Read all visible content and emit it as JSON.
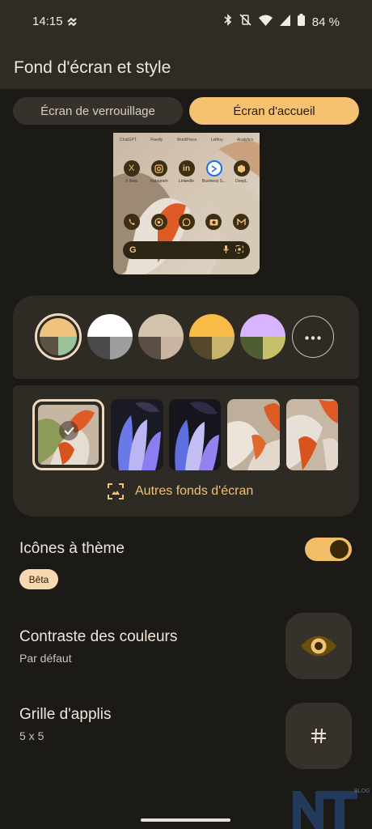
{
  "status_bar": {
    "time": "14:15",
    "battery_percent": "84 %",
    "icons": [
      "vpn-key-icon",
      "bluetooth-icon",
      "vibrate-off-icon",
      "wifi-icon",
      "cellular-signal-icon",
      "battery-icon"
    ]
  },
  "header": {
    "title": "Fond d'écran et style"
  },
  "tabs": [
    {
      "label": "Écran de verrouillage",
      "selected": false
    },
    {
      "label": "Écran d'accueil",
      "selected": true
    }
  ],
  "preview": {
    "dock_labels": [
      "ChatGPT",
      "Feedly",
      "WordPress",
      "LeMoy",
      "Analytics"
    ],
    "apps": [
      "X Beta",
      "Instagram",
      "LinkedIn",
      "Business S...",
      "DeepL"
    ],
    "dock_icons": [
      "phone-icon",
      "chrome-icon",
      "whatsapp-icon",
      "camera-icon",
      "gmail-icon"
    ],
    "search_letter": "G"
  },
  "color_options": [
    {
      "colors": [
        "#efc27e",
        "#5c5343",
        "#9bc29a"
      ],
      "selected": true
    },
    {
      "colors": [
        "#ffffff",
        "#4a4a4a",
        "#9e9e9e"
      ],
      "selected": false
    },
    {
      "colors": [
        "#d2c3ad",
        "#5a4f45",
        "#c8b4a0"
      ],
      "selected": false
    },
    {
      "colors": [
        "#f8bb45",
        "#55482a",
        "#c7b36d"
      ],
      "selected": false
    },
    {
      "colors": [
        "#d7b4ff",
        "#4f5d32",
        "#c7c06a"
      ],
      "selected": false
    }
  ],
  "more_colors_icon": "more-horiz-icon",
  "wallpapers_more_label": "Autres fonds d'écran",
  "settings": {
    "themed_icons": {
      "label": "Icônes à thème",
      "badge": "Bêta",
      "enabled": true
    },
    "contrast": {
      "label": "Contraste des couleurs",
      "value": "Par défaut"
    },
    "grid": {
      "label": "Grille d'applis",
      "value": "5 x 5"
    }
  },
  "watermark": "BLOG"
}
